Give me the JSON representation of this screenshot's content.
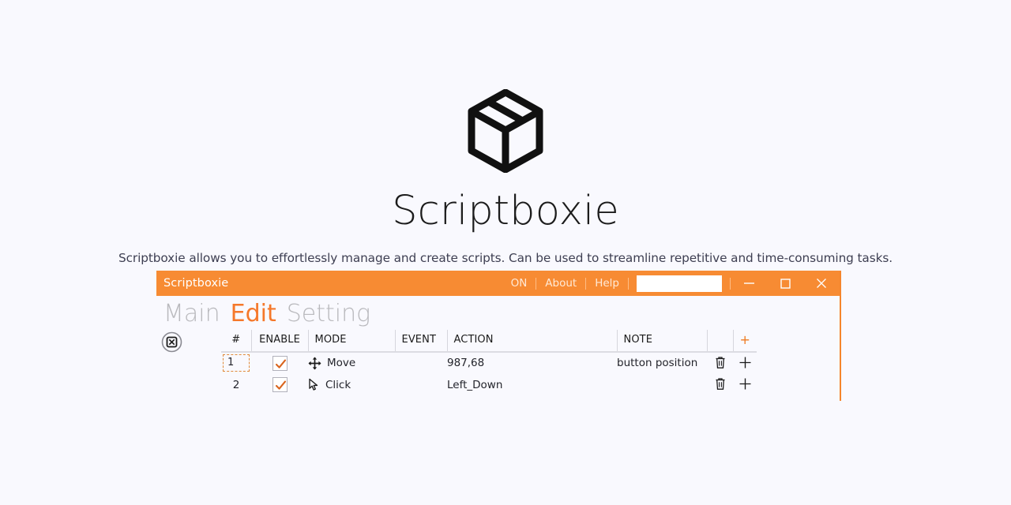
{
  "page": {
    "background_color": "#f9f9fe"
  },
  "hero": {
    "logo_icon": "box-package-icon",
    "title": "Scriptboxie",
    "subtitle": "Scriptboxie allows you to effortlessly manage and create scripts. Can be used to streamline repetitive and time-consuming tasks."
  },
  "app_window": {
    "accent_color": "#f78b33",
    "titlebar": {
      "title": "Scriptboxie",
      "on_toggle": "ON",
      "about": "About",
      "help": "Help",
      "search_value": "",
      "search_placeholder": "",
      "minimize_icon": "minimize-icon",
      "maximize_icon": "maximize-icon",
      "close_icon": "close-icon"
    },
    "tabs": [
      {
        "label": "Main",
        "active": false
      },
      {
        "label": "Edit",
        "active": true
      },
      {
        "label": "Setting",
        "active": false
      }
    ],
    "corner_icon": "stop-boxed-x-icon",
    "table": {
      "headers": {
        "index": "#",
        "enable": "ENABLE",
        "mode": "MODE",
        "event": "EVENT",
        "action": "ACTION",
        "note": "NOTE",
        "delete": "",
        "add": "+"
      },
      "rows": [
        {
          "index": "1",
          "index_selected": true,
          "enabled": true,
          "mode_icon": "move-arrows-icon",
          "mode": "Move",
          "event": "",
          "action": "987,68",
          "note": "button position",
          "note_color": "#46a96b",
          "delete_icon": "trash-icon",
          "add_icon": "plus-icon"
        },
        {
          "index": "2",
          "index_selected": false,
          "enabled": true,
          "mode_icon": "cursor-click-icon",
          "mode": "Click",
          "event": "",
          "action": "Left_Down",
          "note": "",
          "note_color": "#46a96b",
          "delete_icon": "trash-icon",
          "add_icon": "plus-icon"
        }
      ]
    }
  }
}
